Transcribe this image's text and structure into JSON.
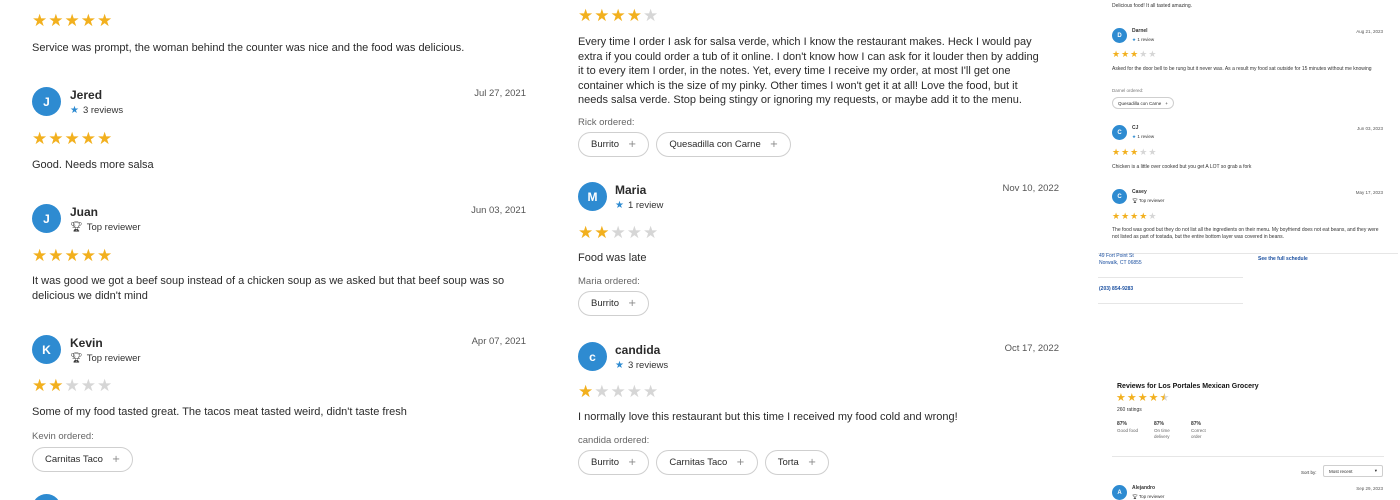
{
  "left_column": {
    "top_review": {
      "rating": 5,
      "text": "Service was prompt, the woman behind the counter was nice and the food was delicious."
    },
    "reviews": [
      {
        "initial": "J",
        "name": "Jered",
        "badge_icon": "star-icon",
        "badge": "3 reviews",
        "date": "Jul 27, 2021",
        "rating": 5,
        "text": "Good. Needs more salsa"
      },
      {
        "initial": "J",
        "name": "Juan",
        "badge_icon": "trophy-icon",
        "badge": "Top reviewer",
        "date": "Jun 03, 2021",
        "rating": 5,
        "text": "It was good we got a beef soup instead of a chicken soup as we asked but that beef soup was so delicious we didn't mind"
      },
      {
        "initial": "K",
        "name": "Kevin",
        "badge_icon": "trophy-icon",
        "badge": "Top reviewer",
        "date": "Apr 07, 2021",
        "rating": 2,
        "text": "Some of my food tasted great. The tacos meat tasted weird, didn't taste fresh",
        "ordered": "Kevin ordered:",
        "items": [
          "Carnitas Taco"
        ]
      }
    ]
  },
  "middle_column": {
    "top_review": {
      "rating": 4,
      "text": "Every time I order I ask for salsa verde, which I know the restaurant makes. Heck I would pay extra if you could order a tub of it online. I don't know how I can ask for it louder then by adding it to every item I order, in the notes. Yet, every time I receive my order, at most I'll get one container which is the size of my pinky. Other times I won't get it at all! Love the food, but it needs salsa verde. Stop being stingy or ignoring my requests, or maybe add it to the menu.",
      "ordered": "Rick ordered:",
      "items": [
        "Burrito",
        "Quesadilla con Carne"
      ]
    },
    "reviews": [
      {
        "initial": "M",
        "name": "Maria",
        "badge_icon": "star-icon",
        "badge": "1 review",
        "date": "Nov 10, 2022",
        "rating": 2,
        "text": "Food was late",
        "ordered": "Maria ordered:",
        "items": [
          "Burrito"
        ]
      },
      {
        "initial": "c",
        "name": "candida",
        "badge_icon": "star-icon",
        "badge": "3 reviews",
        "date": "Oct 17, 2022",
        "rating": 1,
        "text": "I normally love this restaurant but this time I received my food cold and wrong!",
        "ordered": "candida ordered:",
        "items": [
          "Burrito",
          "Carnitas Taco",
          "Torta"
        ]
      }
    ]
  },
  "sidebar": {
    "top_text": "Delicious food! It all tasted amazing.",
    "reviews": [
      {
        "initial": "D",
        "name": "Darnel",
        "badge": "1 review",
        "date": "Aug 21, 2023",
        "rating": 3,
        "text": "Asked for the door bell to be rung but it never was. As a result my food sat outside for 15 minutes without me knowing",
        "ordered": "Darnel ordered:",
        "item": "Quesadilla con Carne"
      },
      {
        "initial": "C",
        "name": "CJ",
        "badge": "1 review",
        "date": "Jun 03, 2023",
        "rating": 3,
        "text": "Chicken is a little over cooked but you get A LOT so grab a fork"
      },
      {
        "initial": "C",
        "name": "Casey",
        "badge": "Top reviewer",
        "date": "May 17, 2023",
        "rating": 4,
        "text": "The food was good but they do not list all the ingredients on their menu. My boyfriend does not eat beans, and they were not listed as part of tostada, but the entire bottom layer was covered in beans."
      }
    ],
    "address_line1": "49 Fort Point St",
    "address_line2": "Norwalk, CT 06855",
    "schedule_link": "See the full schedule",
    "phone": "(203) 854-9283",
    "summary": {
      "title": "Reviews for Los Portales Mexican Grocery",
      "rating": 4.5,
      "ratings_count": "260 ratings",
      "stats": [
        {
          "value": "87%",
          "label": "Good food"
        },
        {
          "value": "87%",
          "label": "On time delivery"
        },
        {
          "value": "87%",
          "label": "Correct order"
        }
      ],
      "sort_label": "Sort by:",
      "sort_value": "Most recent"
    },
    "last_review": {
      "initial": "A",
      "name": "Alejandro",
      "badge": "Top reviewer",
      "date": "Sep 29, 2023"
    }
  },
  "colors": {
    "star": "#f2b01e",
    "star_empty": "#d6d6d6",
    "avatar": "#2e8bd1",
    "link": "#1a4fa0"
  }
}
